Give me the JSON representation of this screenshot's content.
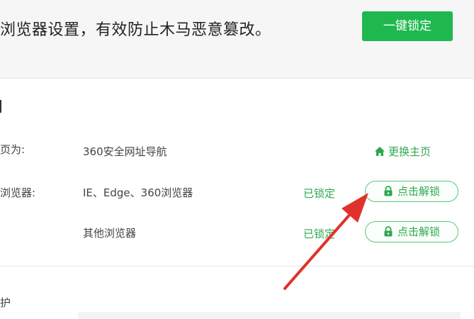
{
  "banner": {
    "text": "浏览器设置，有效防止木马恶意篡改。",
    "lock_all_button": "一键锁定"
  },
  "homepage_row": {
    "label": "页为:",
    "value": "360安全网址导航",
    "change_link": "更换主页",
    "icon": "home-icon"
  },
  "browser_rows": [
    {
      "label": "浏览器:",
      "value": "IE、Edge、360浏览器",
      "status": "已锁定",
      "unlock_button": "点击解锁"
    },
    {
      "label": "",
      "value": "其他浏览器",
      "status": "已锁定",
      "unlock_button": "点击解锁"
    }
  ],
  "bottom_section": {
    "label": "护"
  },
  "colors": {
    "accent_green": "#1fb84f",
    "link_green": "#2ea84f",
    "arrow_red": "#e0322b"
  }
}
